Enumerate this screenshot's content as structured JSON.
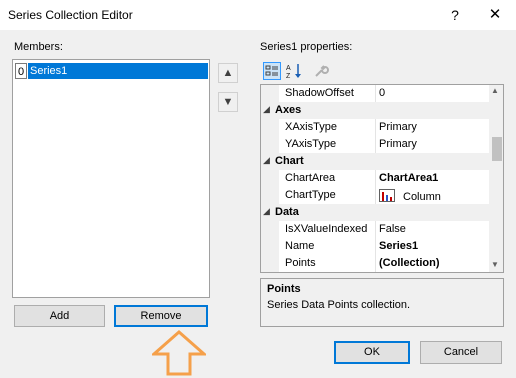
{
  "window": {
    "title": "Series Collection Editor",
    "help_glyph": "?",
    "close_glyph": "✕"
  },
  "members": {
    "label": "Members:",
    "items": [
      {
        "index": "0",
        "name": "Series1",
        "selected": true
      }
    ],
    "add_label": "Add",
    "remove_label": "Remove"
  },
  "properties": {
    "label": "Series1 properties:",
    "rows": [
      {
        "kind": "prop",
        "name": "ShadowOffset",
        "value": "0",
        "bold": false
      },
      {
        "kind": "cat",
        "name": "Axes"
      },
      {
        "kind": "prop",
        "name": "XAxisType",
        "value": "Primary",
        "bold": false
      },
      {
        "kind": "prop",
        "name": "YAxisType",
        "value": "Primary",
        "bold": false
      },
      {
        "kind": "cat",
        "name": "Chart"
      },
      {
        "kind": "prop",
        "name": "ChartArea",
        "value": "ChartArea1",
        "bold": true
      },
      {
        "kind": "prop",
        "name": "ChartType",
        "value": "Column",
        "bold": false,
        "icon": "column-chart-icon"
      },
      {
        "kind": "cat",
        "name": "Data"
      },
      {
        "kind": "prop",
        "name": "IsXValueIndexed",
        "value": "False",
        "bold": false
      },
      {
        "kind": "prop",
        "name": "Name",
        "value": "Series1",
        "bold": true
      },
      {
        "kind": "prop",
        "name": "Points",
        "value": "(Collection)",
        "bold": true
      }
    ],
    "description_title": "Points",
    "description_text": "Series Data Points collection."
  },
  "dialog": {
    "ok_label": "OK",
    "cancel_label": "Cancel"
  },
  "colors": {
    "accent": "#0078d7",
    "annotation": "#f5a04a"
  }
}
